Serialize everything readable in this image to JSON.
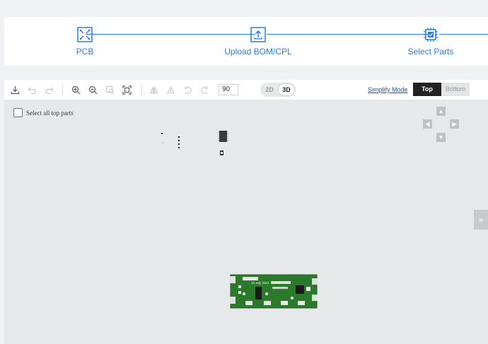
{
  "steps": [
    {
      "label": "PCB",
      "icon": "pcb-icon"
    },
    {
      "label": "Upload BOM/CPL",
      "icon": "upload-icon"
    },
    {
      "label": "Select Parts",
      "icon": "chip-check-icon"
    }
  ],
  "accent_color": "#2d7be0",
  "toolbar": {
    "zoom_value": "90",
    "dim_2d": "2D",
    "dim_3d": "3D",
    "active_dim": "3D",
    "simplify_label": "Simplify Mode",
    "top_label": "Top",
    "bottom_label": "Bottom",
    "active_face": "Top",
    "icons": [
      "download-icon",
      "undo-icon",
      "redo-icon",
      "zoom-in-icon",
      "zoom-out-icon",
      "zoom-window-icon",
      "fit-view-icon",
      "flip-horizontal-icon",
      "flip-vertical-icon",
      "rotate-left-icon",
      "rotate-right-icon"
    ]
  },
  "canvas": {
    "select_all_label": "Select all top parts",
    "select_all_checked": false,
    "board_color": "#2b7a2b",
    "board_text": "15 July 2024"
  }
}
